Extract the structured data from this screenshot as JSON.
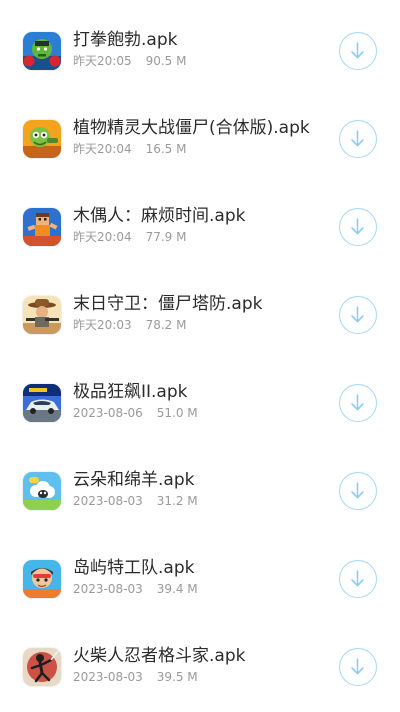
{
  "downloads": [
    {
      "name": "打拳飽勃.apk",
      "date": "昨天20:05",
      "size": "90.5 M",
      "icon": "hulk-boxer-icon"
    },
    {
      "name": "植物精灵大战僵尸(合体版).apk",
      "date": "昨天20:04",
      "size": "16.5 M",
      "icon": "plants-zombies-icon"
    },
    {
      "name": "木偶人：麻烦时间.apk",
      "date": "昨天20:04",
      "size": "77.9 M",
      "icon": "ragdoll-icon"
    },
    {
      "name": "末日守卫：僵尸塔防.apk",
      "date": "昨天20:03",
      "size": "78.2 M",
      "icon": "cowboy-shooter-icon"
    },
    {
      "name": "极品狂飙II.apk",
      "date": "2023-08-06",
      "size": "51.0 M",
      "icon": "race-car-icon"
    },
    {
      "name": "云朵和绵羊.apk",
      "date": "2023-08-03",
      "size": "31.2 M",
      "icon": "sheep-cloud-icon"
    },
    {
      "name": "岛屿特工队.apk",
      "date": "2023-08-03",
      "size": "39.4 M",
      "icon": "island-agent-icon"
    },
    {
      "name": "火柴人忍者格斗家.apk",
      "date": "2023-08-03",
      "size": "39.5 M",
      "icon": "stickman-ninja-icon"
    }
  ],
  "colors": {
    "title": "#2b2b2b",
    "meta": "#9a9a9a",
    "download_ring": "#a6d8f5",
    "download_arrow": "#8ecfee"
  },
  "button_icon": "download-arrow-icon"
}
